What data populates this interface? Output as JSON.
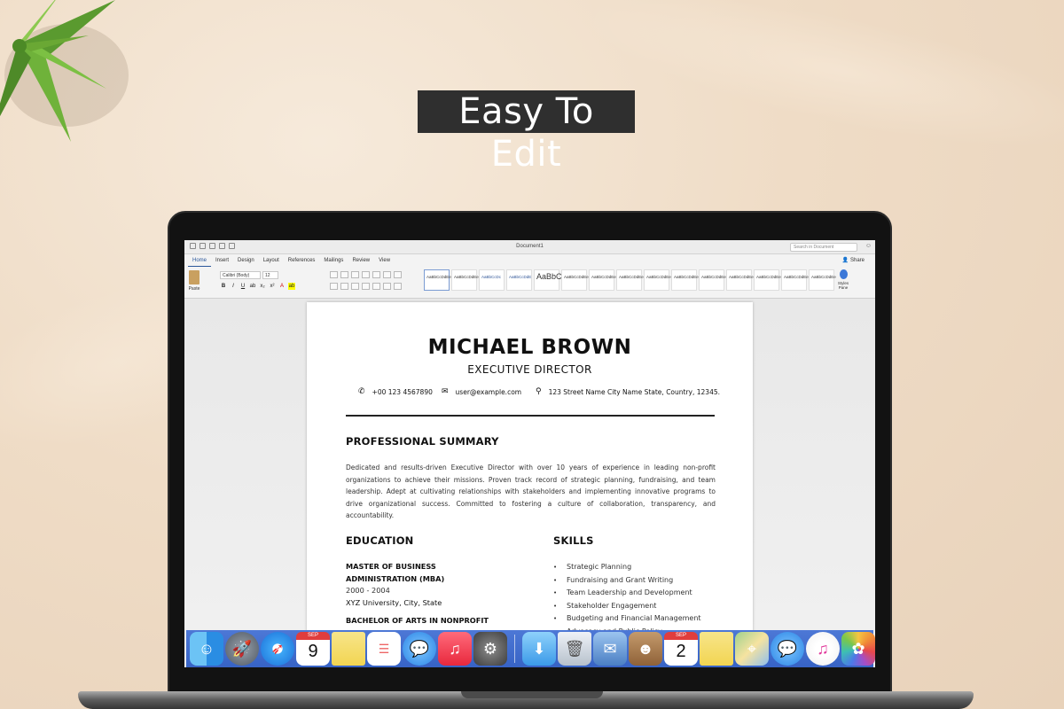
{
  "banner": {
    "title": "Easy To Edit"
  },
  "word": {
    "window_title": "Document1",
    "search_placeholder": "Search in Document",
    "share_label": "Share",
    "tabs": [
      "Home",
      "Insert",
      "Design",
      "Layout",
      "References",
      "Mailings",
      "Review",
      "View"
    ],
    "active_tab": "Home",
    "paste_label": "Paste",
    "font_name": "Calibri (Body)",
    "font_size": "12",
    "styles": [
      {
        "sample": "AaBbCcDdEe",
        "name": "Normal"
      },
      {
        "sample": "AaBbCcDdEe",
        "name": "No Spacing"
      },
      {
        "sample": "AaBbCcDc",
        "name": "Heading 1"
      },
      {
        "sample": "AaBbCcDdE",
        "name": "Heading 2"
      },
      {
        "sample": "AaBbC",
        "name": "Title"
      },
      {
        "sample": "AaBbCcDdEe",
        "name": "Subtitle"
      },
      {
        "sample": "AaBbCcDdEe",
        "name": "Subtle Emph..."
      },
      {
        "sample": "AaBbCcDdEe",
        "name": "Emphasis"
      },
      {
        "sample": "AaBbCcDdEe",
        "name": "Intense Emph..."
      },
      {
        "sample": "AaBbCcDdEe",
        "name": "Strong"
      },
      {
        "sample": "AaBbCcDdEe",
        "name": "Quote"
      },
      {
        "sample": "AaBbCcDdEe",
        "name": "Intense Quote"
      },
      {
        "sample": "AaBbCcDdEe",
        "name": "Subtle Refer..."
      },
      {
        "sample": "AaBbCcDdEe",
        "name": "Intense Refer..."
      },
      {
        "sample": "AaBbCcDdEe",
        "name": "Book Title"
      }
    ],
    "styles_pane_label": "Styles Pane"
  },
  "resume": {
    "name": "MICHAEL BROWN",
    "role": "EXECUTIVE DIRECTOR",
    "phone": "+00 123 4567890",
    "email": "user@example.com",
    "address": "123 Street Name City Name State, Country, 12345.",
    "summary_heading": "PROFESSIONAL SUMMARY",
    "summary": "Dedicated and results-driven Executive Director with over 10 years of experience in leading non-profit organizations to achieve their missions. Proven track record of strategic planning, fundraising, and team leadership. Adept at cultivating relationships with stakeholders and implementing innovative programs to drive organizational success. Committed to fostering a culture of collaboration, transparency, and accountability.",
    "education_heading": "EDUCATION",
    "degree1_line1": "MASTER OF BUSINESS",
    "degree1_line2": "ADMINISTRATION (MBA)",
    "degree1_years": "2000 - 2004",
    "degree1_school": "XYZ University, City, State",
    "degree2_line1": "BACHELOR OF ARTS IN NONPROFIT",
    "skills_heading": "SKILLS",
    "skills": [
      "Strategic Planning",
      "Fundraising and Grant Writing",
      "Team Leadership and Development",
      "Stakeholder Engagement",
      "Budgeting and Financial Management",
      "Advocacy and Public Policy"
    ]
  },
  "dock": {
    "calendar_month": "SEP",
    "calendar_day": "9",
    "calendar2_day": "2",
    "apps": [
      "finder",
      "launchpad",
      "safari",
      "calendar",
      "notes",
      "reminders",
      "messages",
      "music",
      "system-preferences",
      "downloads",
      "trash",
      "mail",
      "contacts",
      "calendar",
      "notes",
      "maps",
      "messages",
      "itunes",
      "photos"
    ]
  }
}
